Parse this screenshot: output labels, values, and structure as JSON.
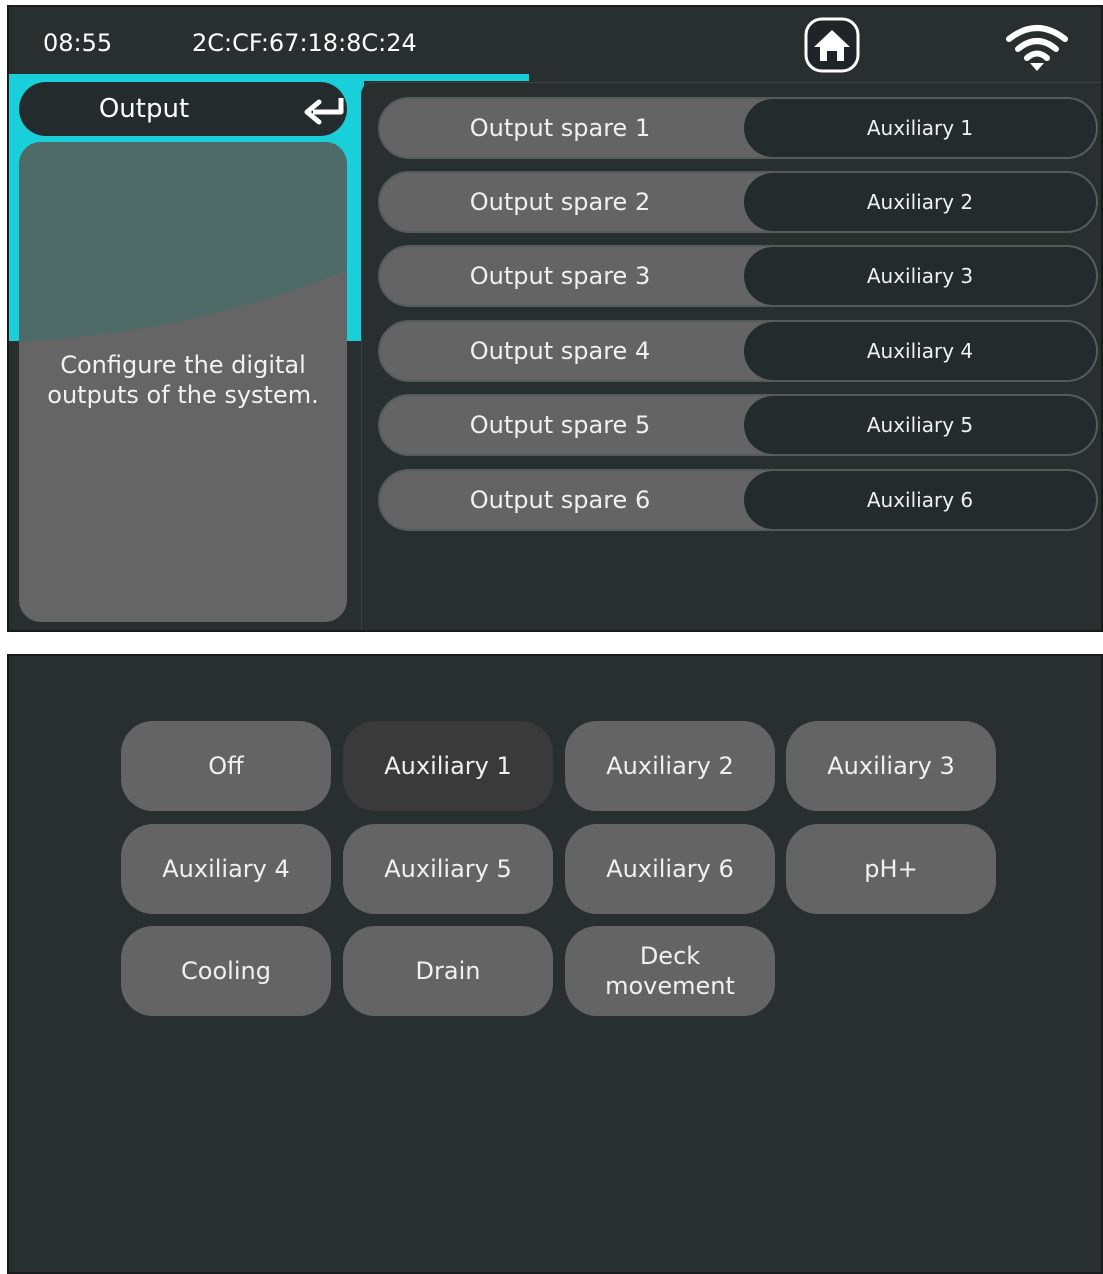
{
  "status_bar": {
    "time": "08:55",
    "mac_address": "2C:CF:67:18:8C:24",
    "home_icon": "home-icon",
    "wifi_icon": "wifi-icon"
  },
  "panel": {
    "title": "Output",
    "back_icon": "back-arrow-icon",
    "description": "Configure the digital outputs of the system."
  },
  "outputs": [
    {
      "label": "Output spare 1",
      "value": "Auxiliary 1"
    },
    {
      "label": "Output spare 2",
      "value": "Auxiliary 2"
    },
    {
      "label": "Output spare 3",
      "value": "Auxiliary 3"
    },
    {
      "label": "Output spare 4",
      "value": "Auxiliary 4"
    },
    {
      "label": "Output spare 5",
      "value": "Auxiliary 5"
    },
    {
      "label": "Output spare 6",
      "value": "Auxiliary 6"
    }
  ],
  "options": {
    "selected": "Auxiliary 1",
    "items": [
      "Off",
      "Auxiliary 1",
      "Auxiliary 2",
      "Auxiliary 3",
      "Auxiliary 4",
      "Auxiliary 5",
      "Auxiliary 6",
      "pH+",
      "Cooling",
      "Drain",
      "Deck movement"
    ]
  },
  "colors": {
    "accent": "#19cfd9",
    "background": "#292e2f",
    "button": "#646464",
    "value_pill": "#242b2c",
    "selected_button": "#3a3a3a"
  }
}
